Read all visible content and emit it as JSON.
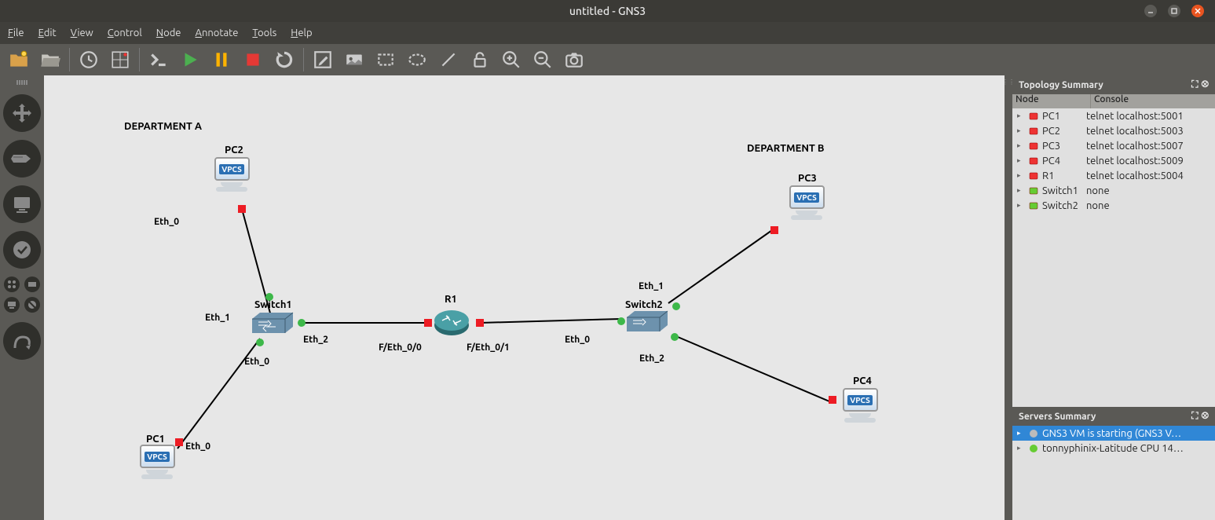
{
  "window": {
    "title": "untitled - GNS3"
  },
  "menu": [
    "File",
    "Edit",
    "View",
    "Control",
    "Node",
    "Annotate",
    "Tools",
    "Help"
  ],
  "topology": {
    "title": "Topology Summary",
    "columns": [
      "Node",
      "Console"
    ],
    "rows": [
      {
        "status": "red",
        "name": "PC1",
        "console": "telnet localhost:5001"
      },
      {
        "status": "red",
        "name": "PC2",
        "console": "telnet localhost:5003"
      },
      {
        "status": "red",
        "name": "PC3",
        "console": "telnet localhost:5007"
      },
      {
        "status": "red",
        "name": "PC4",
        "console": "telnet localhost:5009"
      },
      {
        "status": "red",
        "name": "R1",
        "console": "telnet localhost:5004"
      },
      {
        "status": "green",
        "name": "Switch1",
        "console": "none"
      },
      {
        "status": "green",
        "name": "Switch2",
        "console": "none"
      }
    ]
  },
  "servers": {
    "title": "Servers Summary",
    "rows": [
      {
        "sel": true,
        "status": "grey",
        "text": "GNS3 VM is starting (GNS3 V…"
      },
      {
        "sel": false,
        "status": "green",
        "text": "tonnyphinix-Latitude CPU 14…"
      }
    ]
  },
  "canvas": {
    "dept_a": "DEPARTMENT A",
    "dept_b": "DEPARTMENT B",
    "nodes": {
      "pc1": {
        "label": "PC1",
        "badge": "VPCS"
      },
      "pc2": {
        "label": "PC2",
        "badge": "VPCS"
      },
      "pc3": {
        "label": "PC3",
        "badge": "VPCS"
      },
      "pc4": {
        "label": "PC4",
        "badge": "VPCS"
      },
      "sw1": {
        "label": "Switch1"
      },
      "sw2": {
        "label": "Switch2"
      },
      "r1": {
        "label": "R1"
      }
    },
    "ifaces": {
      "pc2_e0": "Eth_0",
      "pc1_e0": "Eth_0",
      "sw1_e1": "Eth_1",
      "sw1_e0": "Eth_0",
      "sw1_e2": "Eth_2",
      "r1_f00": "F/Eth_0/0",
      "r1_f01": "F/Eth_0/1",
      "sw2_e0": "Eth_0",
      "sw2_e1": "Eth_1",
      "sw2_e2": "Eth_2",
      "pc3_lbl": "",
      "pc4_lbl": ""
    }
  }
}
